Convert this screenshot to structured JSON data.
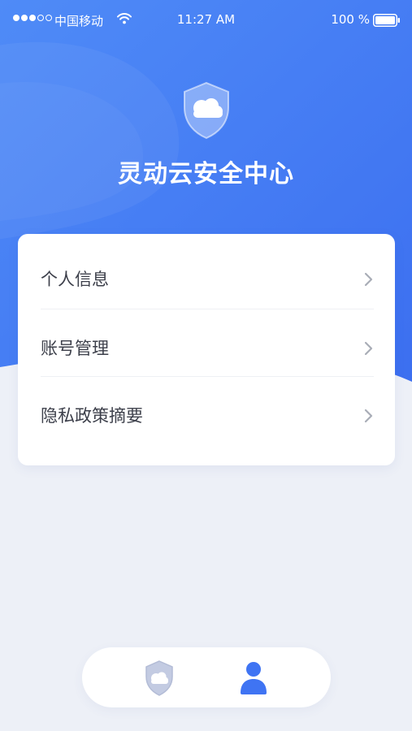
{
  "status_bar": {
    "signal_icon": "signal-dots-icon",
    "carrier": "中国移动",
    "wifi_icon": "wifi-icon",
    "time": "11:27 AM",
    "battery_percent": "100 %",
    "battery_icon": "battery-full-icon"
  },
  "header": {
    "logo_icon": "cloud-shield-icon",
    "title": "灵动云安全中心"
  },
  "menu": {
    "items": [
      {
        "label": "个人信息",
        "icon": "chevron-right-icon"
      },
      {
        "label": "账号管理",
        "icon": "chevron-right-icon"
      },
      {
        "label": "隐私政策摘要",
        "icon": "chevron-right-icon"
      }
    ]
  },
  "tab_bar": {
    "tabs": [
      {
        "icon": "cloud-shield-icon",
        "active": false
      },
      {
        "icon": "user-icon",
        "active": true
      }
    ]
  },
  "colors": {
    "primary": "#3f74f3",
    "primary_light": "#4f8cf6",
    "background": "#edf0f7",
    "inactive_icon": "#b9c1d9"
  }
}
